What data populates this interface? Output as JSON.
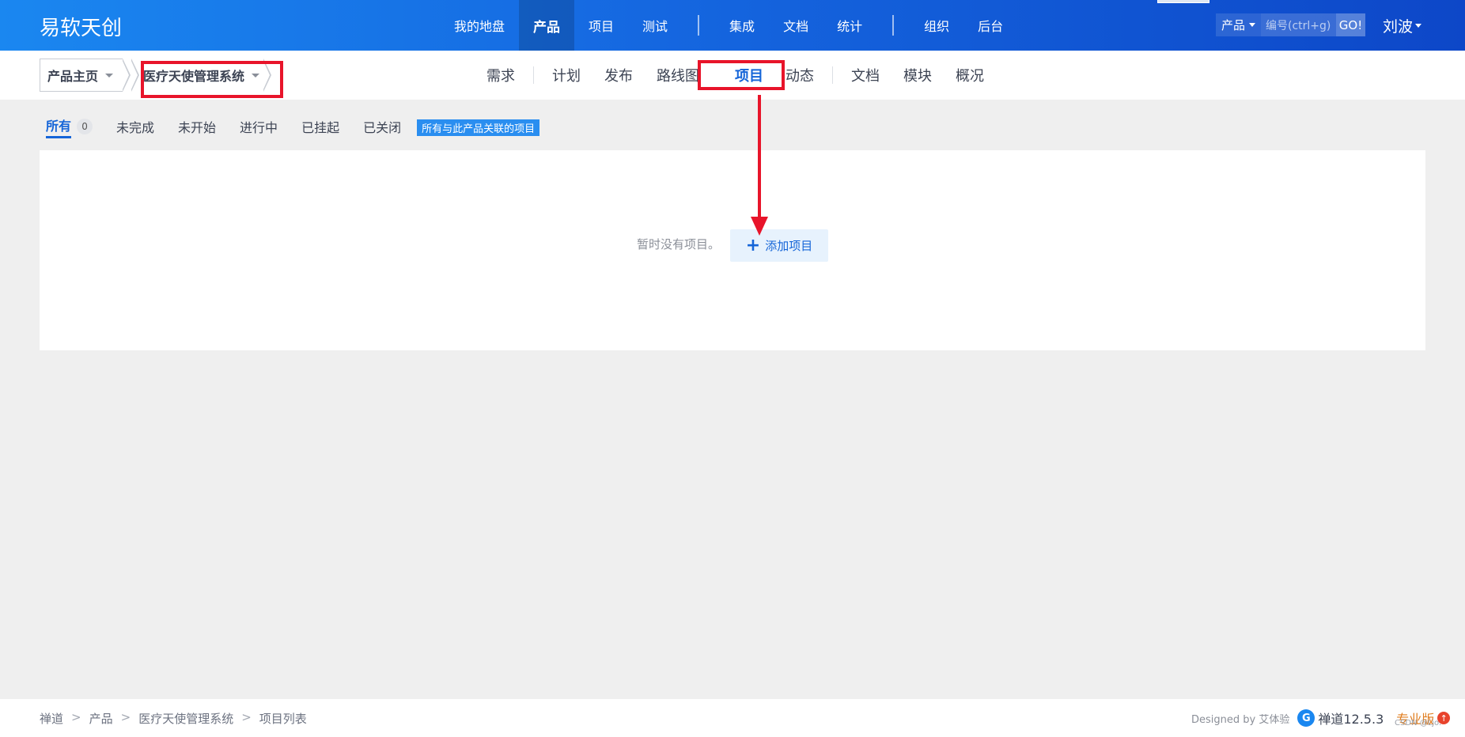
{
  "header": {
    "brand": "易软天创",
    "nav": [
      {
        "label": "我的地盘",
        "active": false
      },
      {
        "label": "产品",
        "active": true
      },
      {
        "label": "项目",
        "active": false
      },
      {
        "label": "测试",
        "active": false
      },
      {
        "label": "集成",
        "active": false
      },
      {
        "label": "文档",
        "active": false
      },
      {
        "label": "统计",
        "active": false
      },
      {
        "label": "组织",
        "active": false
      },
      {
        "label": "后台",
        "active": false
      }
    ],
    "search_type": "产品",
    "search_placeholder": "编号(ctrl+g)",
    "go_label": "GO!",
    "user": "刘波"
  },
  "subnav": {
    "crumb_home": "产品主页",
    "crumb_product": "医疗天使管理系统",
    "items": [
      {
        "label": "需求",
        "active": false
      },
      {
        "label": "计划",
        "active": false
      },
      {
        "label": "发布",
        "active": false
      },
      {
        "label": "路线图",
        "active": false
      },
      {
        "label": "项目",
        "active": true
      },
      {
        "label": "动态",
        "active": false
      },
      {
        "label": "文档",
        "active": false
      },
      {
        "label": "模块",
        "active": false
      },
      {
        "label": "概况",
        "active": false
      }
    ]
  },
  "tabs": [
    {
      "label": "所有",
      "count": "0",
      "active": true
    },
    {
      "label": "未完成",
      "active": false
    },
    {
      "label": "未开始",
      "active": false
    },
    {
      "label": "进行中",
      "active": false
    },
    {
      "label": "已挂起",
      "active": false
    },
    {
      "label": "已关闭",
      "active": false
    }
  ],
  "assoc_label": "所有与此产品关联的项目",
  "content": {
    "empty_text": "暂时没有项目。",
    "add_button": "添加项目"
  },
  "footer": {
    "breadcrumb": [
      "禅道",
      "产品",
      "医疗天使管理系统",
      "项目列表"
    ],
    "designed_by": "Designed by 艾体验",
    "version": "禅道12.5.3",
    "edition": "专业版"
  },
  "watermark": "CSDN @Ljo.",
  "colors": {
    "header_start": "#1a87f0",
    "header_end": "#0d47c8",
    "accent": "#1565d8",
    "annotation_red": "#e8142a",
    "edition_orange": "#e07c1d"
  }
}
